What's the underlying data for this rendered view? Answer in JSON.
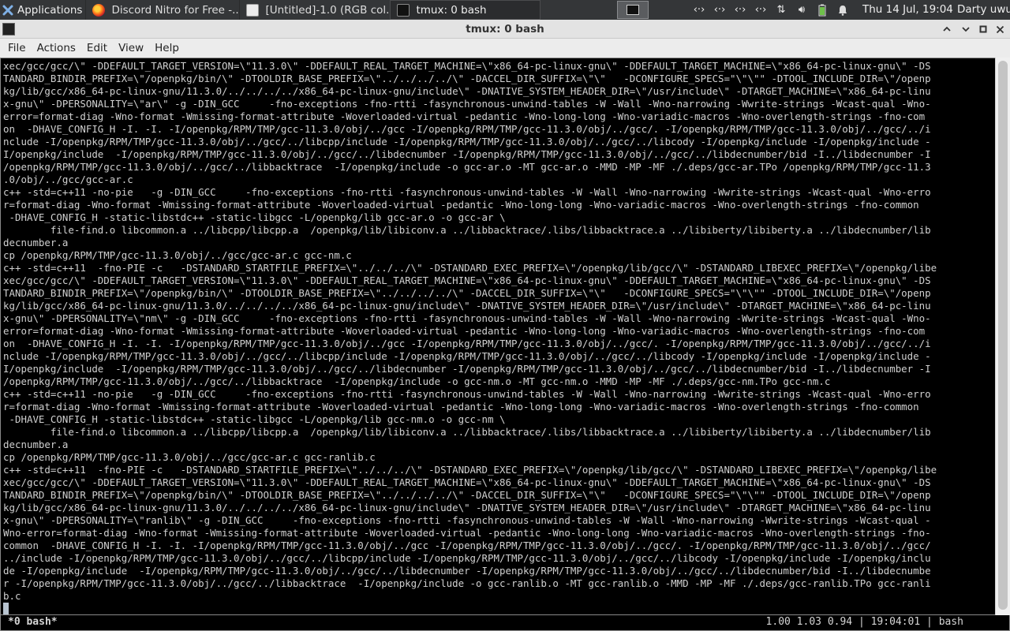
{
  "taskbar": {
    "app_menu_label": "Applications",
    "tasks": [
      {
        "label": "Discord Nitro for Free -...",
        "icon": "firefox-icon"
      },
      {
        "label": "[Untitled]-1.0 (RGB col...",
        "icon": "gimp-icon"
      },
      {
        "label": "tmux: 0 bash",
        "icon": "terminal-icon"
      }
    ],
    "clock": "Thu 14 Jul, 19:04",
    "user": "Darty uwu"
  },
  "window": {
    "title": "tmux: 0 bash",
    "minimize_glyph": "^",
    "maximize_glyph": "▪",
    "close_glyph": "✕"
  },
  "menu": [
    "File",
    "Actions",
    "Edit",
    "View",
    "Help"
  ],
  "terminal": {
    "lines": [
      "xec/gcc/gcc/\\\" -DDEFAULT_TARGET_VERSION=\\\"11.3.0\\\" -DDEFAULT_REAL_TARGET_MACHINE=\\\"x86_64-pc-linux-gnu\\\" -DDEFAULT_TARGET_MACHINE=\\\"x86_64-pc-linux-gnu\\\" -DS",
      "TANDARD_BINDIR_PREFIX=\\\"/openpkg/bin/\\\" -DTOOLDIR_BASE_PREFIX=\\\"../../../../\\\" -DACCEL_DIR_SUFFIX=\\\"\\\"   -DCONFIGURE_SPECS=\"\\\"\\\"\" -DTOOL_INCLUDE_DIR=\\\"/openp",
      "kg/lib/gcc/x86_64-pc-linux-gnu/11.3.0/../../../../x86_64-pc-linux-gnu/include\\\" -DNATIVE_SYSTEM_HEADER_DIR=\\\"/usr/include\\\" -DTARGET_MACHINE=\\\"x86_64-pc-linu",
      "x-gnu\\\" -DPERSONALITY=\\\"ar\\\" -g -DIN_GCC     -fno-exceptions -fno-rtti -fasynchronous-unwind-tables -W -Wall -Wno-narrowing -Wwrite-strings -Wcast-qual -Wno-",
      "error=format-diag -Wno-format -Wmissing-format-attribute -Woverloaded-virtual -pedantic -Wno-long-long -Wno-variadic-macros -Wno-overlength-strings -fno-com",
      "on  -DHAVE_CONFIG_H -I. -I. -I/openpkg/RPM/TMP/gcc-11.3.0/obj/../gcc -I/openpkg/RPM/TMP/gcc-11.3.0/obj/../gcc/. -I/openpkg/RPM/TMP/gcc-11.3.0/obj/../gcc/../i",
      "nclude -I/openpkg/RPM/TMP/gcc-11.3.0/obj/../gcc/../libcpp/include -I/openpkg/RPM/TMP/gcc-11.3.0/obj/../gcc/../libcody -I/openpkg/include -I/openpkg/include -",
      "I/openpkg/include  -I/openpkg/RPM/TMP/gcc-11.3.0/obj/../gcc/../libdecnumber -I/openpkg/RPM/TMP/gcc-11.3.0/obj/../gcc/../libdecnumber/bid -I../libdecnumber -I",
      "/openpkg/RPM/TMP/gcc-11.3.0/obj/../gcc/../libbacktrace  -I/openpkg/include -o gcc-ar.o -MT gcc-ar.o -MMD -MP -MF ./.deps/gcc-ar.TPo /openpkg/RPM/TMP/gcc-11.3",
      ".0/obj/../gcc/gcc-ar.c",
      "c++ -std=c++11 -no-pie   -g -DIN_GCC     -fno-exceptions -fno-rtti -fasynchronous-unwind-tables -W -Wall -Wno-narrowing -Wwrite-strings -Wcast-qual -Wno-erro",
      "r=format-diag -Wno-format -Wmissing-format-attribute -Woverloaded-virtual -pedantic -Wno-long-long -Wno-variadic-macros -Wno-overlength-strings -fno-common",
      " -DHAVE_CONFIG_H -static-libstdc++ -static-libgcc -L/openpkg/lib gcc-ar.o -o gcc-ar \\",
      "        file-find.o libcommon.a ../libcpp/libcpp.a  /openpkg/lib/libiconv.a ../libbacktrace/.libs/libbacktrace.a ../libiberty/libiberty.a ../libdecnumber/lib",
      "decnumber.a",
      "cp /openpkg/RPM/TMP/gcc-11.3.0/obj/../gcc/gcc-ar.c gcc-nm.c",
      "c++ -std=c++11  -fno-PIE -c   -DSTANDARD_STARTFILE_PREFIX=\\\"../../../\\\" -DSTANDARD_EXEC_PREFIX=\\\"/openpkg/lib/gcc/\\\" -DSTANDARD_LIBEXEC_PREFIX=\\\"/openpkg/libe",
      "xec/gcc/gcc/\\\" -DDEFAULT_TARGET_VERSION=\\\"11.3.0\\\" -DDEFAULT_REAL_TARGET_MACHINE=\\\"x86_64-pc-linux-gnu\\\" -DDEFAULT_TARGET_MACHINE=\\\"x86_64-pc-linux-gnu\\\" -DS",
      "TANDARD_BINDIR_PREFIX=\\\"/openpkg/bin/\\\" -DTOOLDIR_BASE_PREFIX=\\\"../../../../\\\" -DACCEL_DIR_SUFFIX=\\\"\\\"   -DCONFIGURE_SPECS=\"\\\"\\\"\" -DTOOL_INCLUDE_DIR=\\\"/openp",
      "kg/lib/gcc/x86_64-pc-linux-gnu/11.3.0/../../../../x86_64-pc-linux-gnu/include\\\" -DNATIVE_SYSTEM_HEADER_DIR=\\\"/usr/include\\\" -DTARGET_MACHINE=\\\"x86_64-pc-linu",
      "x-gnu\\\" -DPERSONALITY=\\\"nm\\\" -g -DIN_GCC     -fno-exceptions -fno-rtti -fasynchronous-unwind-tables -W -Wall -Wno-narrowing -Wwrite-strings -Wcast-qual -Wno-",
      "error=format-diag -Wno-format -Wmissing-format-attribute -Woverloaded-virtual -pedantic -Wno-long-long -Wno-variadic-macros -Wno-overlength-strings -fno-com",
      "on  -DHAVE_CONFIG_H -I. -I. -I/openpkg/RPM/TMP/gcc-11.3.0/obj/../gcc -I/openpkg/RPM/TMP/gcc-11.3.0/obj/../gcc/. -I/openpkg/RPM/TMP/gcc-11.3.0/obj/../gcc/../i",
      "nclude -I/openpkg/RPM/TMP/gcc-11.3.0/obj/../gcc/../libcpp/include -I/openpkg/RPM/TMP/gcc-11.3.0/obj/../gcc/../libcody -I/openpkg/include -I/openpkg/include -",
      "I/openpkg/include  -I/openpkg/RPM/TMP/gcc-11.3.0/obj/../gcc/../libdecnumber -I/openpkg/RPM/TMP/gcc-11.3.0/obj/../gcc/../libdecnumber/bid -I../libdecnumber -I",
      "/openpkg/RPM/TMP/gcc-11.3.0/obj/../gcc/../libbacktrace  -I/openpkg/include -o gcc-nm.o -MT gcc-nm.o -MMD -MP -MF ./.deps/gcc-nm.TPo gcc-nm.c",
      "c++ -std=c++11 -no-pie   -g -DIN_GCC     -fno-exceptions -fno-rtti -fasynchronous-unwind-tables -W -Wall -Wno-narrowing -Wwrite-strings -Wcast-qual -Wno-erro",
      "r=format-diag -Wno-format -Wmissing-format-attribute -Woverloaded-virtual -pedantic -Wno-long-long -Wno-variadic-macros -Wno-overlength-strings -fno-common",
      " -DHAVE_CONFIG_H -static-libstdc++ -static-libgcc -L/openpkg/lib gcc-nm.o -o gcc-nm \\",
      "        file-find.o libcommon.a ../libcpp/libcpp.a  /openpkg/lib/libiconv.a ../libbacktrace/.libs/libbacktrace.a ../libiberty/libiberty.a ../libdecnumber/lib",
      "decnumber.a",
      "cp /openpkg/RPM/TMP/gcc-11.3.0/obj/../gcc/gcc-ar.c gcc-ranlib.c",
      "c++ -std=c++11  -fno-PIE -c   -DSTANDARD_STARTFILE_PREFIX=\\\"../../../\\\" -DSTANDARD_EXEC_PREFIX=\\\"/openpkg/lib/gcc/\\\" -DSTANDARD_LIBEXEC_PREFIX=\\\"/openpkg/libe",
      "xec/gcc/gcc/\\\" -DDEFAULT_TARGET_VERSION=\\\"11.3.0\\\" -DDEFAULT_REAL_TARGET_MACHINE=\\\"x86_64-pc-linux-gnu\\\" -DDEFAULT_TARGET_MACHINE=\\\"x86_64-pc-linux-gnu\\\" -DS",
      "TANDARD_BINDIR_PREFIX=\\\"/openpkg/bin/\\\" -DTOOLDIR_BASE_PREFIX=\\\"../../../../\\\" -DACCEL_DIR_SUFFIX=\\\"\\\"   -DCONFIGURE_SPECS=\"\\\"\\\"\" -DTOOL_INCLUDE_DIR=\\\"/openp",
      "kg/lib/gcc/x86_64-pc-linux-gnu/11.3.0/../../../../x86_64-pc-linux-gnu/include\\\" -DNATIVE_SYSTEM_HEADER_DIR=\\\"/usr/include\\\" -DTARGET_MACHINE=\\\"x86_64-pc-linu",
      "x-gnu\\\" -DPERSONALITY=\\\"ranlib\\\" -g -DIN_GCC     -fno-exceptions -fno-rtti -fasynchronous-unwind-tables -W -Wall -Wno-narrowing -Wwrite-strings -Wcast-qual -",
      "Wno-error=format-diag -Wno-format -Wmissing-format-attribute -Woverloaded-virtual -pedantic -Wno-long-long -Wno-variadic-macros -Wno-overlength-strings -fno-",
      "common  -DHAVE_CONFIG_H -I. -I. -I/openpkg/RPM/TMP/gcc-11.3.0/obj/../gcc -I/openpkg/RPM/TMP/gcc-11.3.0/obj/../gcc/. -I/openpkg/RPM/TMP/gcc-11.3.0/obj/../gcc/",
      "../include -I/openpkg/RPM/TMP/gcc-11.3.0/obj/../gcc/../libcpp/include -I/openpkg/RPM/TMP/gcc-11.3.0/obj/../gcc/../libcody -I/openpkg/include -I/openpkg/inclu",
      "de -I/openpkg/include  -I/openpkg/RPM/TMP/gcc-11.3.0/obj/../gcc/../libdecnumber -I/openpkg/RPM/TMP/gcc-11.3.0/obj/../gcc/../libdecnumber/bid -I../libdecnumbe",
      "r -I/openpkg/RPM/TMP/gcc-11.3.0/obj/../gcc/../libbacktrace  -I/openpkg/include -o gcc-ranlib.o -MT gcc-ranlib.o -MMD -MP -MF ./.deps/gcc-ranlib.TPo gcc-ranli",
      "b.c"
    ]
  },
  "tmux_status": {
    "left": "*0 bash*",
    "right": "1.00 1.03 0.94 | 19:04:01 | bash"
  },
  "colors": {
    "panel_bg": "#343638",
    "terminal_bg": "#000000",
    "terminal_fg": "#d0d0d0"
  }
}
